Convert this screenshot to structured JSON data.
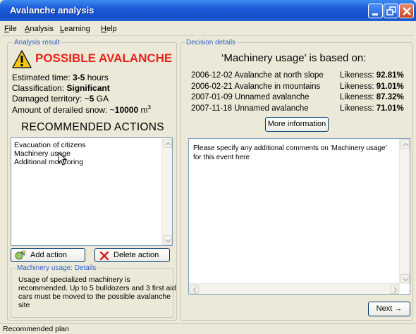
{
  "window": {
    "title": "Avalanche analysis"
  },
  "menu": [
    "File",
    "Analysis",
    "Learning",
    "Help"
  ],
  "analysis": {
    "group_label": "Analysis result",
    "headline": "POSSIBLE AVALANCHE",
    "time_label": "Estimated time: ",
    "time_value": "3-5",
    "time_unit": " hours",
    "class_label": "Classification: ",
    "class_value": "Significant",
    "territory_label": "Damaged territory: ~",
    "territory_value": "5",
    "territory_unit": " GA",
    "snow_label": "Amount of derailed snow: ~",
    "snow_value": "10000",
    "snow_unit": " m",
    "snow_exp": "3",
    "rec_title": "RECOMMENDED ACTIONS",
    "actions": [
      "Evacuation of citizens",
      "Machinery usage",
      "Additional monitoring"
    ],
    "add_button": "Add action",
    "delete_button": "Delete action",
    "details_label": "Machinery usage: Details",
    "details_lines": [
      "Usage of specialized machinery is",
      "recommended. Up to 5 bulldozers and 3 first aid",
      "cars must be moved to the possible avalanche",
      "site"
    ]
  },
  "decision": {
    "group_label": "Decision details",
    "based_on": "‘Machinery usage’ is based on:",
    "likeness_label": "Likeness: ",
    "rows": [
      {
        "event": "2006-12-02 Avalanche at north slope",
        "likeness": "92.81%"
      },
      {
        "event": "2006-02-21 Avalanche in mountains",
        "likeness": "91.01%"
      },
      {
        "event": "2007-01-09 Unnamed avalanche",
        "likeness": "87.32%"
      },
      {
        "event": "2007-11-18 Unnamed avalanche",
        "likeness": "71.01%"
      }
    ],
    "more_button": "More information",
    "comment_text": "Please specify any additional comments on 'Machinery usage' for this event here",
    "next_button": "Next →"
  },
  "status": {
    "text": "Recommended plan"
  }
}
